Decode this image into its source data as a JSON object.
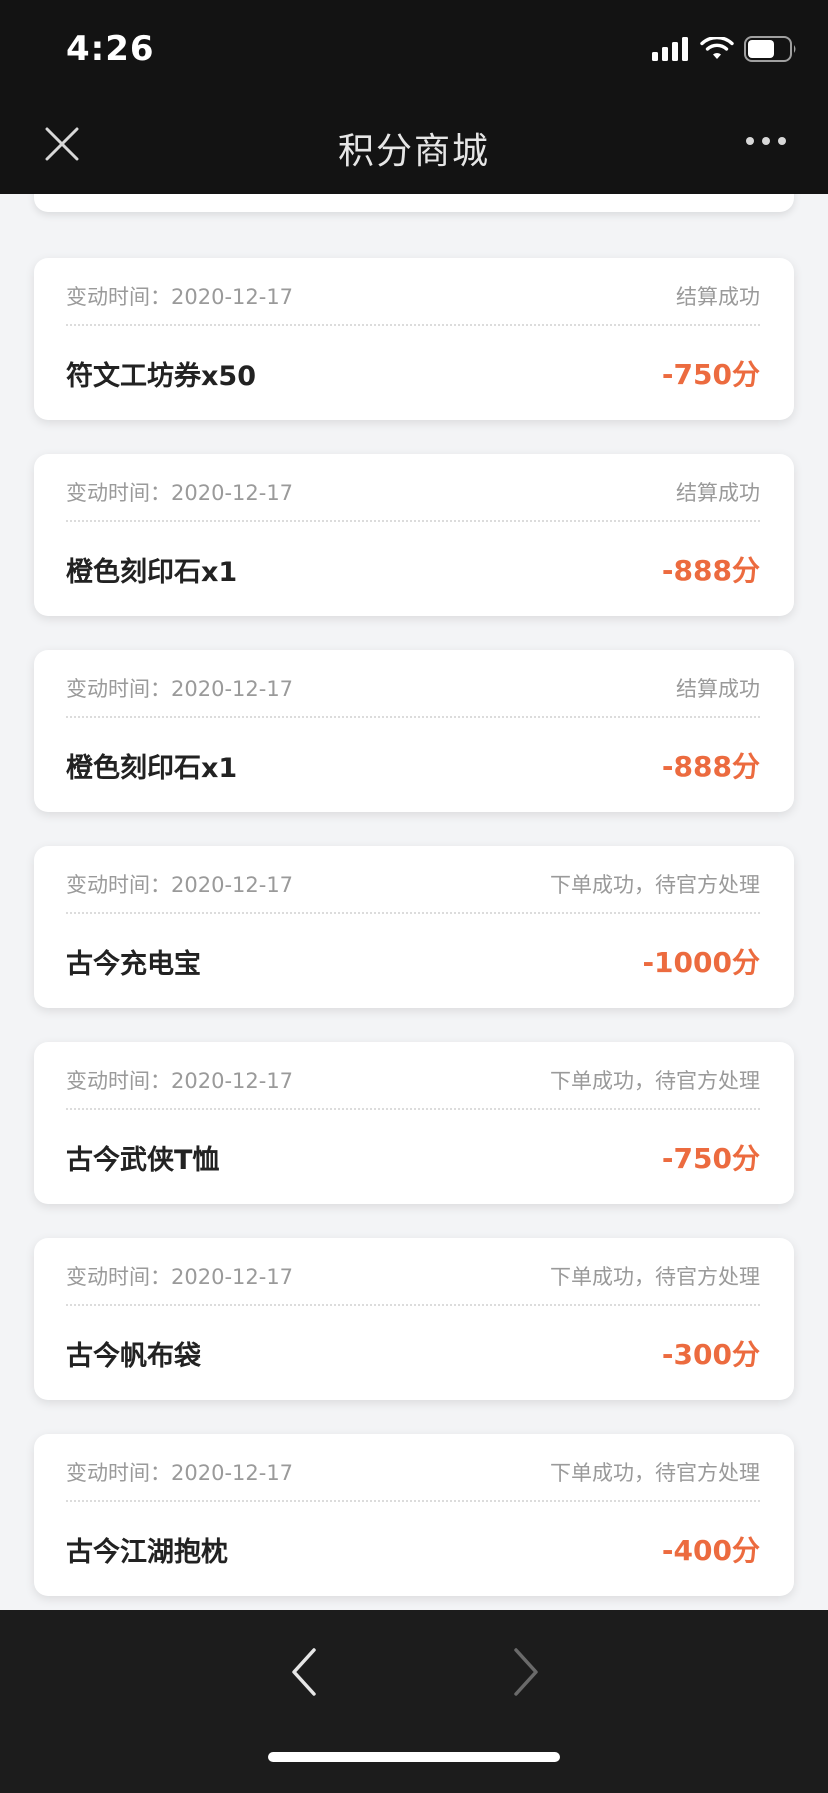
{
  "status_bar": {
    "time": "4:26"
  },
  "nav": {
    "title": "积分商城"
  },
  "records": [
    {
      "time": "变动时间：2020-12-17",
      "status": "结算成功",
      "item": "符文工坊券x50",
      "points": "-750分"
    },
    {
      "time": "变动时间：2020-12-17",
      "status": "结算成功",
      "item": "橙色刻印石x1",
      "points": "-888分"
    },
    {
      "time": "变动时间：2020-12-17",
      "status": "结算成功",
      "item": "橙色刻印石x1",
      "points": "-888分"
    },
    {
      "time": "变动时间：2020-12-17",
      "status": "下单成功，待官方处理",
      "item": "古今充电宝",
      "points": "-1000分"
    },
    {
      "time": "变动时间：2020-12-17",
      "status": "下单成功，待官方处理",
      "item": "古今武侠T恤",
      "points": "-750分"
    },
    {
      "time": "变动时间：2020-12-17",
      "status": "下单成功，待官方处理",
      "item": "古今帆布袋",
      "points": "-300分"
    },
    {
      "time": "变动时间：2020-12-17",
      "status": "下单成功，待官方处理",
      "item": "古今江湖抱枕",
      "points": "-400分"
    }
  ],
  "colors": {
    "accent": "#ec6b3f",
    "topbar": "#131313",
    "bottombar": "#1c1c1c"
  },
  "icons": {
    "close": "close-icon",
    "more": "more-dots-icon",
    "back": "chevron-left-icon",
    "forward": "chevron-right-icon"
  }
}
